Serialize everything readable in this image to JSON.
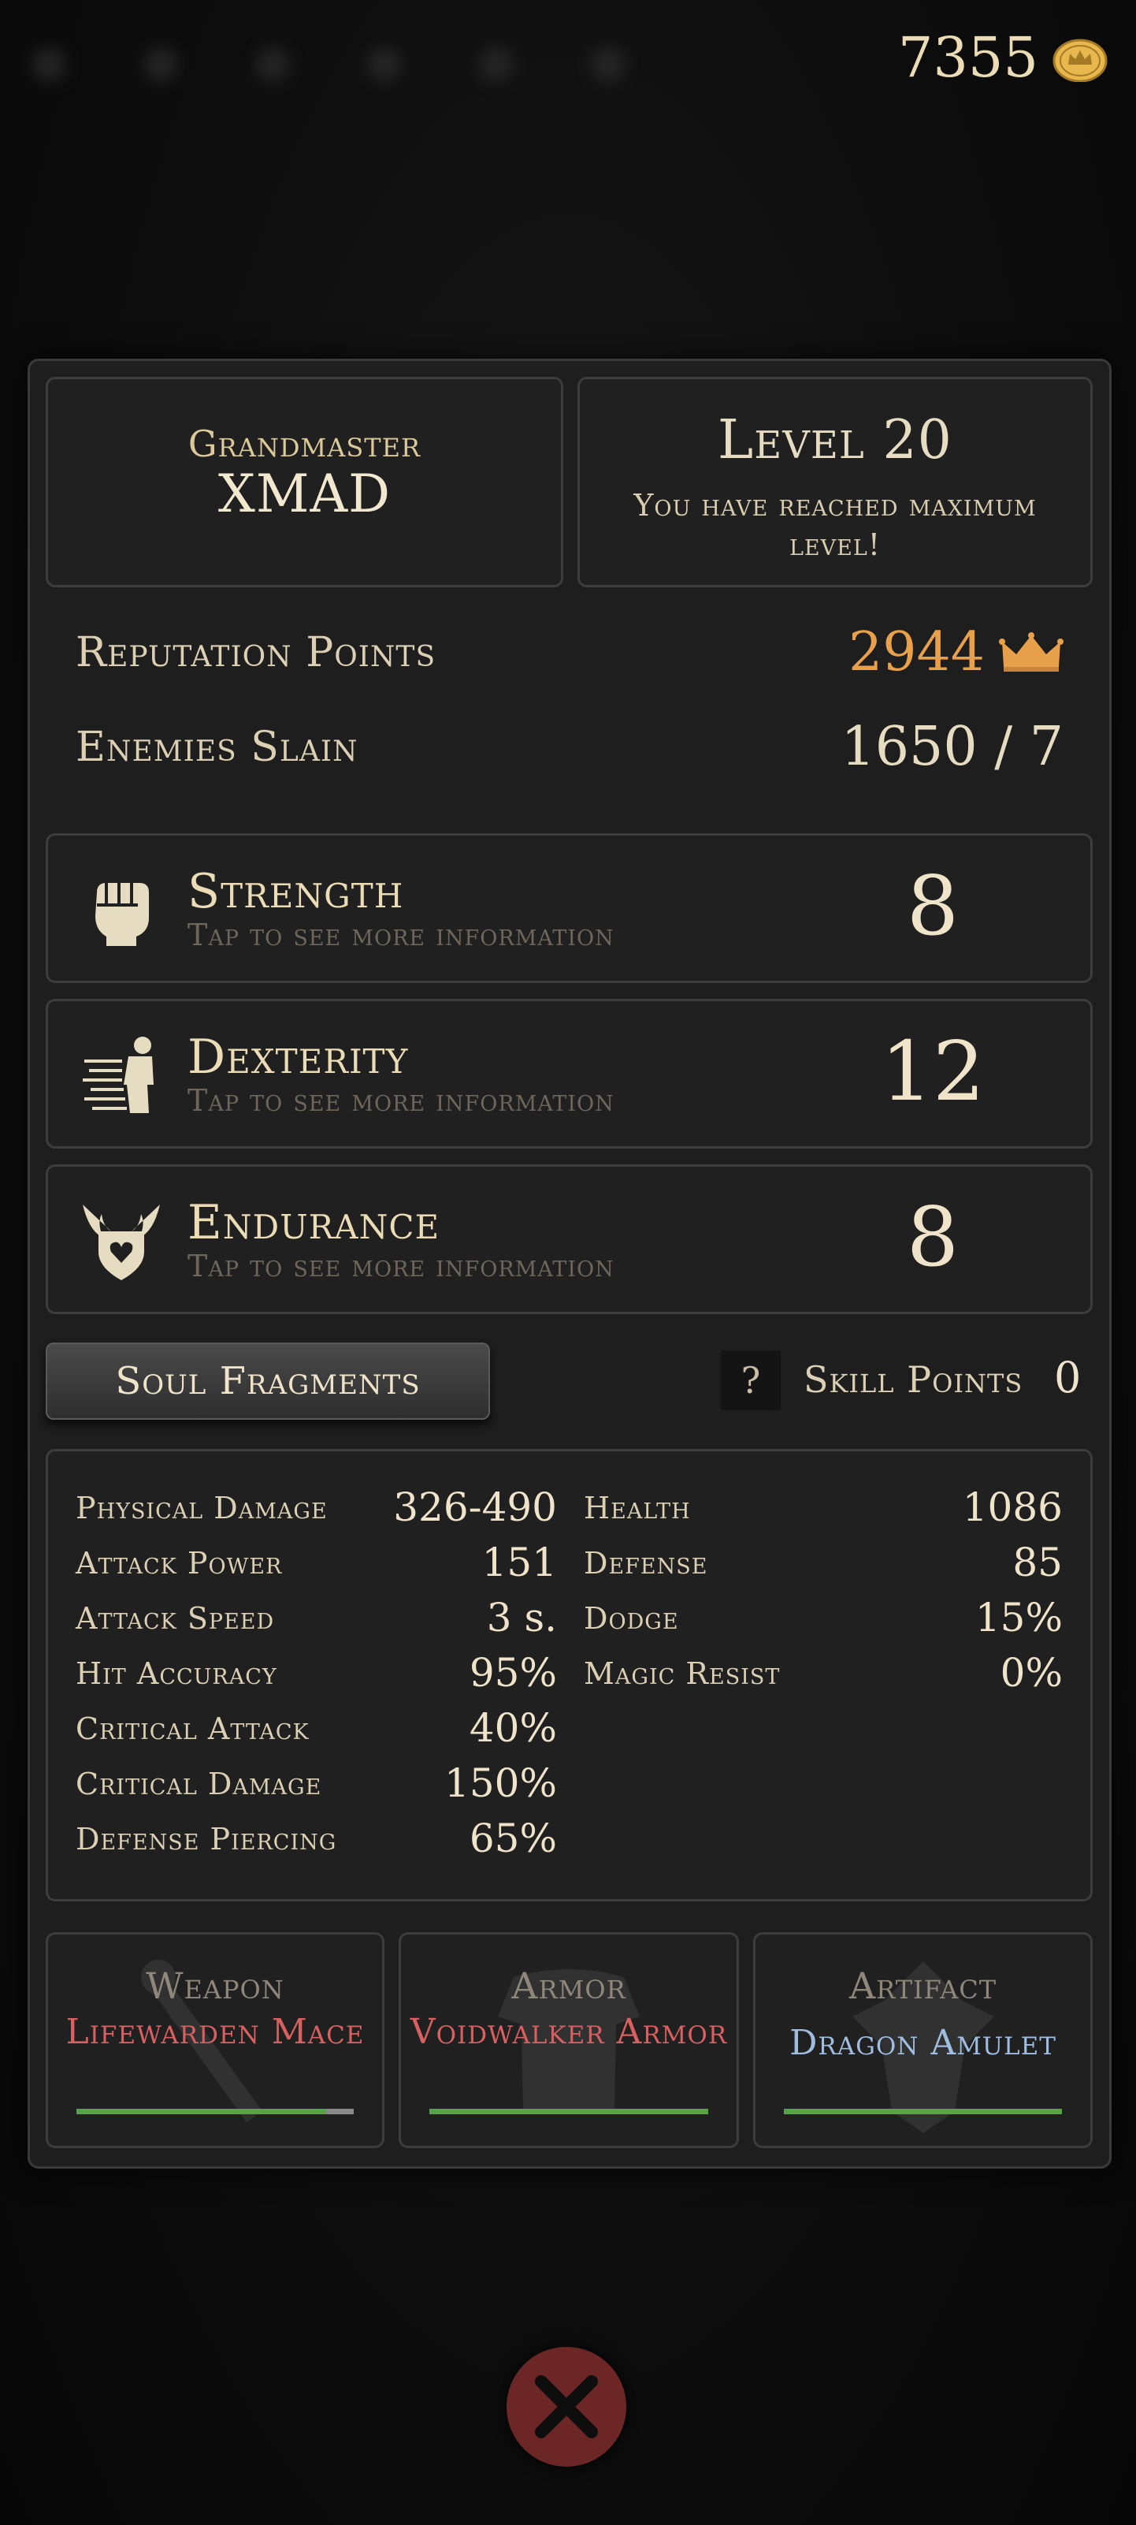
{
  "header": {
    "coins": "7355",
    "coin_icon": "coin-crown-icon"
  },
  "profile": {
    "rank": "Grandmaster",
    "name": "XMAD"
  },
  "level": {
    "title": "Level 20",
    "subtitle": "You have reached maximum level!"
  },
  "reputation": {
    "label": "Reputation Points",
    "value": "2944",
    "icon": "crown-icon",
    "color": "#e8a04a"
  },
  "enemies": {
    "label": "Enemies Slain",
    "value": "1650 / 7"
  },
  "attributes": [
    {
      "name": "Strength",
      "hint": "Tap to see more information",
      "value": "8",
      "icon": "fist-icon"
    },
    {
      "name": "Dexterity",
      "hint": "Tap to see more information",
      "value": "12",
      "icon": "running-figure-icon"
    },
    {
      "name": "Endurance",
      "hint": "Tap to see more information",
      "value": "8",
      "icon": "winged-heart-shield-icon"
    }
  ],
  "soul_fragments": {
    "label": "Soul Fragments"
  },
  "help": {
    "label": "?"
  },
  "skill_points": {
    "label": "Skill Points",
    "value": "0"
  },
  "stats_left": [
    {
      "label": "Physical Damage",
      "value": "326-490"
    },
    {
      "label": "Attack Power",
      "value": "151"
    },
    {
      "label": "Attack Speed",
      "value": "3 s."
    },
    {
      "label": "Hit Accuracy",
      "value": "95%"
    },
    {
      "label": "Critical Attack",
      "value": "40%"
    },
    {
      "label": "Critical Damage",
      "value": "150%"
    },
    {
      "label": "Defense Piercing",
      "value": "65%"
    }
  ],
  "stats_right": [
    {
      "label": "Health",
      "value": "1086"
    },
    {
      "label": "Defense",
      "value": "85"
    },
    {
      "label": "Dodge",
      "value": "15%"
    },
    {
      "label": "Magic Resist",
      "value": "0%"
    }
  ],
  "equipment": [
    {
      "slot": "Weapon",
      "name": "Lifewarden Mace",
      "color": "#d96060",
      "durability": 0.9,
      "icon": "mace-icon"
    },
    {
      "slot": "Armor",
      "name": "Voidwalker Armor",
      "color": "#d96060",
      "durability": 1.0,
      "icon": "armor-icon"
    },
    {
      "slot": "Artifact",
      "name": "Dragon Amulet",
      "color": "#9fbde0",
      "durability": 1.0,
      "icon": "amulet-icon"
    }
  ],
  "close": {
    "icon": "close-icon"
  }
}
